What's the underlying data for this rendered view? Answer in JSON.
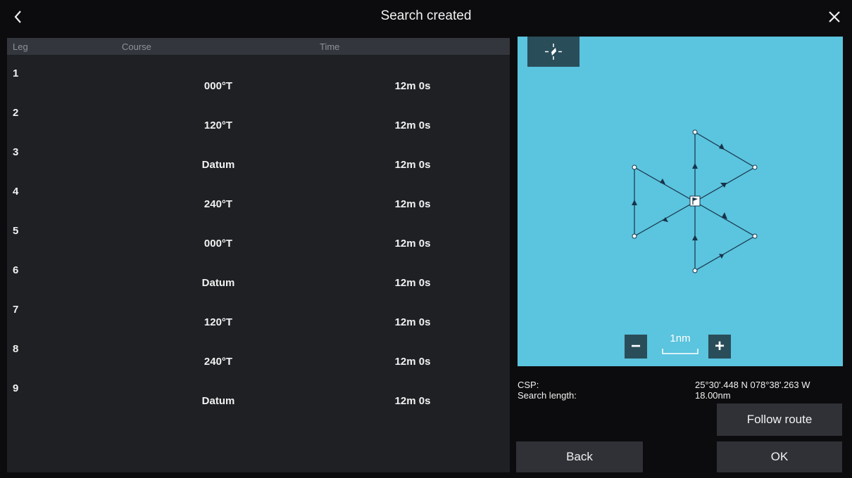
{
  "header": {
    "title": "Search created",
    "back_icon": "chevron-left-icon",
    "close_icon": "close-icon"
  },
  "table": {
    "headers": [
      "Leg",
      "Course",
      "Time"
    ],
    "rows": [
      {
        "leg": "1",
        "course": "000°T",
        "time": "12m  0s"
      },
      {
        "leg": "2",
        "course": "120°T",
        "time": "12m  0s"
      },
      {
        "leg": "3",
        "course": "Datum",
        "time": "12m  0s"
      },
      {
        "leg": "4",
        "course": "240°T",
        "time": "12m  0s"
      },
      {
        "leg": "5",
        "course": "000°T",
        "time": "12m  0s"
      },
      {
        "leg": "6",
        "course": "Datum",
        "time": "12m  0s"
      },
      {
        "leg": "7",
        "course": "120°T",
        "time": "12m  0s"
      },
      {
        "leg": "8",
        "course": "240°T",
        "time": "12m  0s"
      },
      {
        "leg": "9",
        "course": "Datum",
        "time": "12m  0s"
      }
    ]
  },
  "map": {
    "background_color": "#5bc4de",
    "scale_label": "1nm",
    "zoom_out_label": "−",
    "zoom_in_label": "+",
    "center_icon": "center-vessel-icon",
    "datum_icon": "datum-flag-icon"
  },
  "info": {
    "csp_label": "CSP:",
    "csp_value": "25°30'.448 N  078°38'.263 W",
    "length_label": "Search length:",
    "length_value": "18.00nm"
  },
  "buttons": {
    "follow_route": "Follow route",
    "back": "Back",
    "ok": "OK"
  }
}
